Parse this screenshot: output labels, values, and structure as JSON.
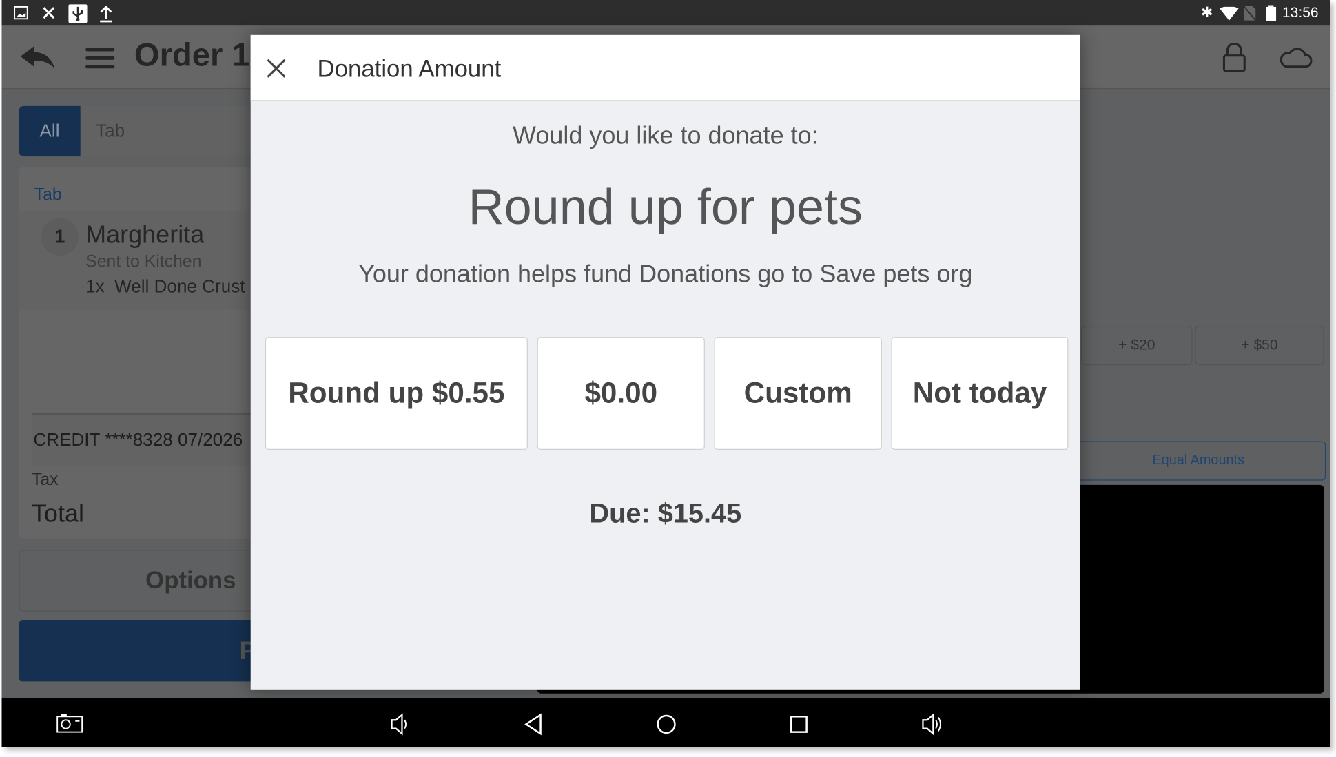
{
  "status_bar": {
    "time": "13:56",
    "left_icons": [
      "image-icon",
      "signal-off-icon",
      "usb-icon",
      "upload-icon"
    ],
    "right_icons": [
      "bluetooth-icon",
      "wifi-icon",
      "no-sim-icon",
      "battery-icon"
    ]
  },
  "header": {
    "title": "Order 1"
  },
  "tabs": [
    {
      "label": "All",
      "active": true
    },
    {
      "label": "Tab",
      "active": false
    }
  ],
  "order": {
    "section": "Tab",
    "items": [
      {
        "qty": "1",
        "name": "Margherita",
        "status": "Sent to Kitchen",
        "modifier": "1x  Well Done Crust"
      }
    ],
    "payment": "CREDIT ****8328 07/2026",
    "tax_label": "Tax",
    "total_label": "Total",
    "options_label": "Options",
    "pay_label": "P"
  },
  "tender": {
    "quick_amounts": [
      "+ $20",
      "+ $50"
    ],
    "equal_amounts_label": "Equal Amounts"
  },
  "modal": {
    "title": "Donation Amount",
    "prompt": "Would you like to donate to:",
    "campaign": "Round up for pets",
    "description": "Your donation helps fund Donations go to Save pets org",
    "options": [
      "Round up $0.55",
      "$0.00",
      "Custom",
      "Not today"
    ],
    "due": "Due: $15.45"
  },
  "colors": {
    "primary": "#153050",
    "accent_text": "#2a5a8c",
    "modal_bg": "#eff0f3"
  }
}
